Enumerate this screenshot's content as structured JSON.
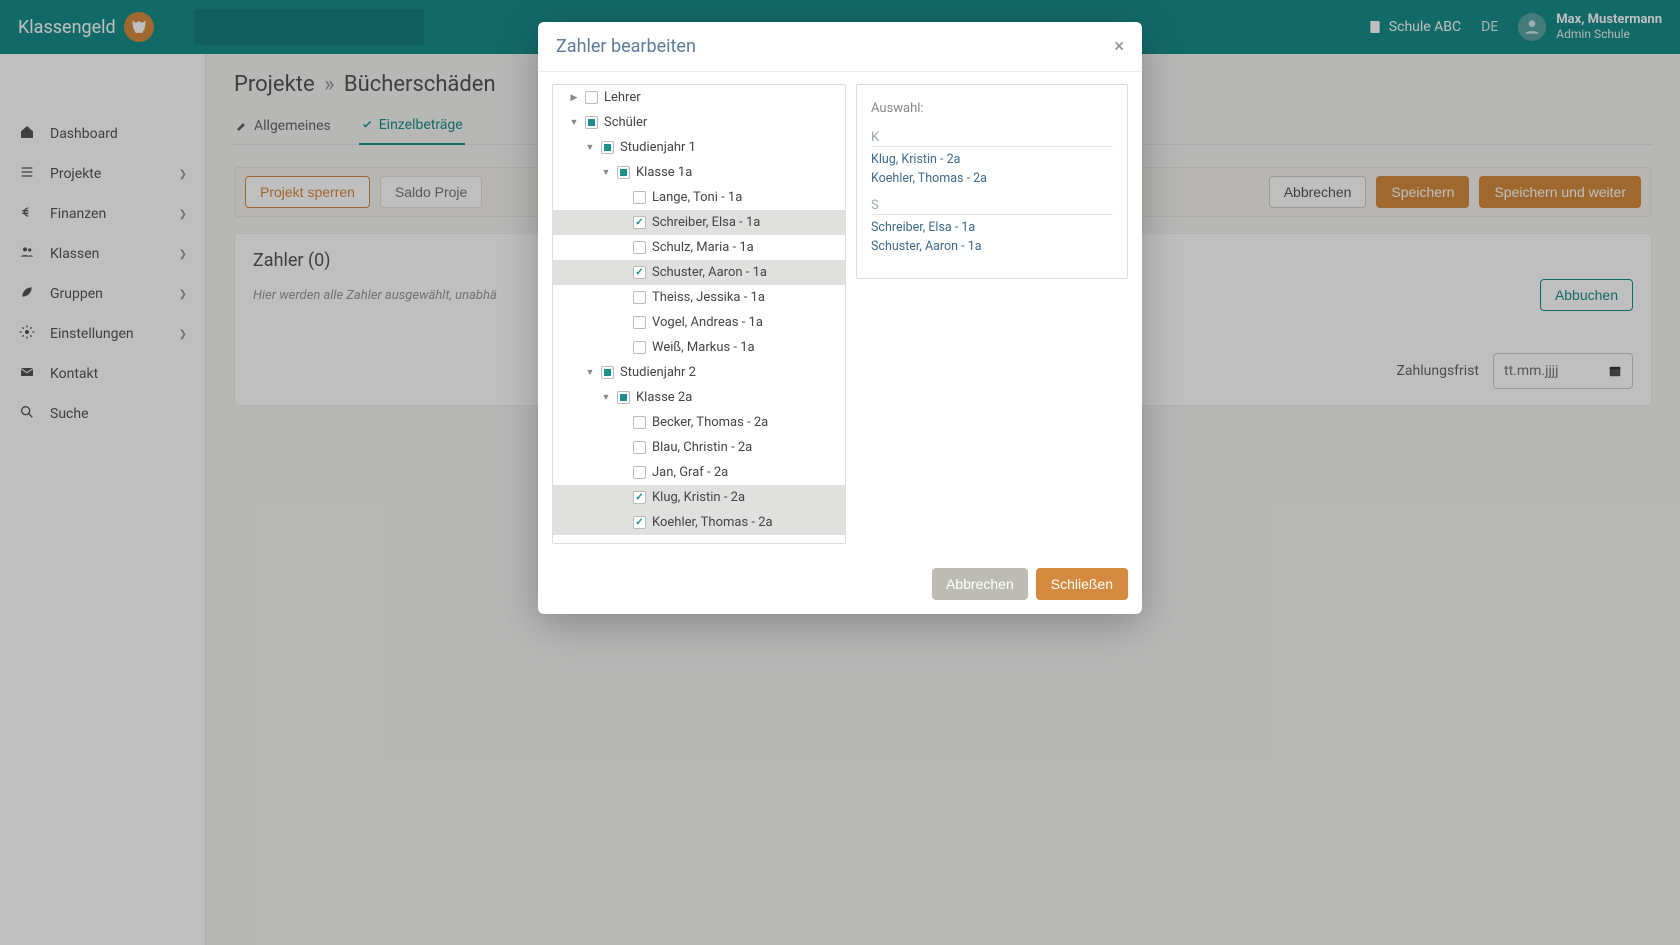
{
  "brand": "Klassengeld",
  "topbar": {
    "school": "Schule ABC",
    "lang": "DE",
    "user_name": "Max, Mustermann",
    "user_role": "Admin Schule"
  },
  "sidebar": {
    "items": [
      {
        "label": "Dashboard",
        "icon": "home",
        "expandable": false
      },
      {
        "label": "Projekte",
        "icon": "list",
        "expandable": true
      },
      {
        "label": "Finanzen",
        "icon": "euro",
        "expandable": true
      },
      {
        "label": "Klassen",
        "icon": "users",
        "expandable": true
      },
      {
        "label": "Gruppen",
        "icon": "leaf",
        "expandable": true
      },
      {
        "label": "Einstellungen",
        "icon": "gear",
        "expandable": true
      },
      {
        "label": "Kontakt",
        "icon": "mail",
        "expandable": false
      },
      {
        "label": "Suche",
        "icon": "search",
        "expandable": false
      }
    ]
  },
  "breadcrumb": {
    "a": "Projekte",
    "sep": "»",
    "b": "Bücherschäden"
  },
  "tabs": {
    "general": "Allgemeines",
    "individual": "Einzelbeträge"
  },
  "toolbar": {
    "lock": "Projekt sperren",
    "saldo": "Saldo Proje",
    "cancel": "Abbrechen",
    "save": "Speichern",
    "save_continue": "Speichern und weiter"
  },
  "panel": {
    "title": "Zahler (0)",
    "hint": "Hier werden alle Zahler ausgewählt, unabhä",
    "debit": "Abbuchen",
    "date_label": "Zahlungsfrist",
    "date_placeholder": "tt.mm.jjjj"
  },
  "modal": {
    "title": "Zahler bearbeiten",
    "selection_title": "Auswahl:",
    "cancel": "Abbrechen",
    "close": "Schließen",
    "tree": [
      {
        "level": 1,
        "exp": "right",
        "check": "empty",
        "label": "Lehrer"
      },
      {
        "level": 1,
        "exp": "down",
        "check": "partial",
        "label": "Schüler"
      },
      {
        "level": 2,
        "exp": "down",
        "check": "partial",
        "label": "Studienjahr 1"
      },
      {
        "level": 3,
        "exp": "down",
        "check": "partial",
        "label": "Klasse 1a"
      },
      {
        "level": 4,
        "exp": "",
        "check": "empty",
        "label": "Lange, Toni - 1a"
      },
      {
        "level": 4,
        "exp": "",
        "check": "checked",
        "label": "Schreiber, Elsa - 1a",
        "sel": true
      },
      {
        "level": 4,
        "exp": "",
        "check": "empty",
        "label": "Schulz, Maria - 1a"
      },
      {
        "level": 4,
        "exp": "",
        "check": "checked",
        "label": "Schuster, Aaron - 1a",
        "sel": true
      },
      {
        "level": 4,
        "exp": "",
        "check": "empty",
        "label": "Theiss, Jessika - 1a"
      },
      {
        "level": 4,
        "exp": "",
        "check": "empty",
        "label": "Vogel, Andreas - 1a"
      },
      {
        "level": 4,
        "exp": "",
        "check": "empty",
        "label": "Weiß, Markus - 1a"
      },
      {
        "level": 2,
        "exp": "down",
        "check": "partial",
        "label": "Studienjahr 2"
      },
      {
        "level": 3,
        "exp": "down",
        "check": "partial",
        "label": "Klasse 2a"
      },
      {
        "level": 4,
        "exp": "",
        "check": "empty",
        "label": "Becker, Thomas - 2a"
      },
      {
        "level": 4,
        "exp": "",
        "check": "empty",
        "label": "Blau, Christin - 2a"
      },
      {
        "level": 4,
        "exp": "",
        "check": "empty",
        "label": "Jan, Graf - 2a"
      },
      {
        "level": 4,
        "exp": "",
        "check": "checked",
        "label": "Klug, Kristin - 2a",
        "sel": true
      },
      {
        "level": 4,
        "exp": "",
        "check": "checked",
        "label": "Koehler, Thomas - 2a",
        "sel": true
      }
    ],
    "selection": [
      {
        "letter": "K",
        "items": [
          "Klug, Kristin - 2a",
          "Koehler, Thomas - 2a"
        ]
      },
      {
        "letter": "S",
        "items": [
          "Schreiber, Elsa - 1a",
          "Schuster, Aaron - 1a"
        ]
      }
    ]
  }
}
